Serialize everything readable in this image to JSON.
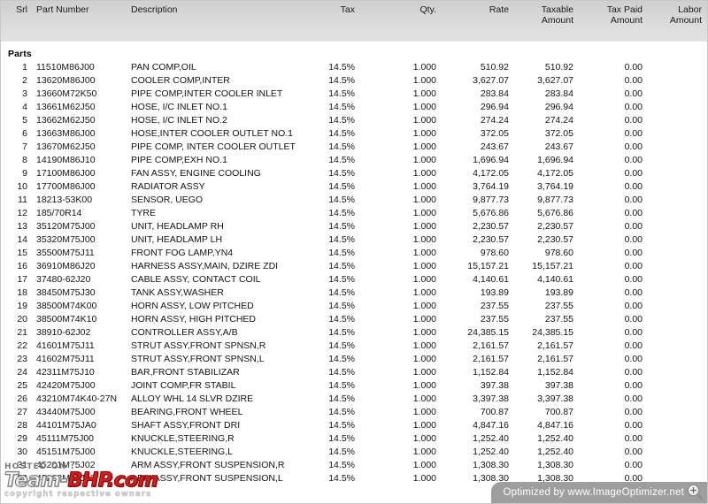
{
  "table": {
    "columns": [
      {
        "key": "srl",
        "label": "Srl"
      },
      {
        "key": "part",
        "label": "Part Number"
      },
      {
        "key": "desc",
        "label": "Description"
      },
      {
        "key": "tax",
        "label": "Tax"
      },
      {
        "key": "qty",
        "label": "Qty."
      },
      {
        "key": "rate",
        "label": "Rate"
      },
      {
        "key": "txbl",
        "label": "Taxable\nAmount"
      },
      {
        "key": "tpaid",
        "label": "Tax Paid\nAmount"
      },
      {
        "key": "labor",
        "label": "Labor\nAmount"
      }
    ],
    "group_label": "Parts",
    "rows": [
      {
        "srl": "1",
        "part": "11510M86J00",
        "desc": "PAN COMP,OIL",
        "tax": "14.5%",
        "qty": "1.000",
        "rate": "510.92",
        "txbl": "510.92",
        "tpaid": "0.00",
        "labor": ""
      },
      {
        "srl": "2",
        "part": "13620M86J00",
        "desc": "COOLER COMP,INTER",
        "tax": "14.5%",
        "qty": "1.000",
        "rate": "3,627.07",
        "txbl": "3,627.07",
        "tpaid": "0.00",
        "labor": ""
      },
      {
        "srl": "3",
        "part": "13660M72K50",
        "desc": "PIPE COMP,INTER COOLER INLET",
        "tax": "14.5%",
        "qty": "1.000",
        "rate": "283.84",
        "txbl": "283.84",
        "tpaid": "0.00",
        "labor": ""
      },
      {
        "srl": "4",
        "part": "13661M62J50",
        "desc": "HOSE, I/C INLET NO.1",
        "tax": "14.5%",
        "qty": "1.000",
        "rate": "296.94",
        "txbl": "296.94",
        "tpaid": "0.00",
        "labor": ""
      },
      {
        "srl": "5",
        "part": "13662M62J50",
        "desc": "HOSE, I/C INLET NO.2",
        "tax": "14.5%",
        "qty": "1.000",
        "rate": "274.24",
        "txbl": "274.24",
        "tpaid": "0.00",
        "labor": ""
      },
      {
        "srl": "6",
        "part": "13663M86J00",
        "desc": "HOSE,INTER COOLER OUTLET NO.1",
        "tax": "14.5%",
        "qty": "1.000",
        "rate": "372.05",
        "txbl": "372.05",
        "tpaid": "0.00",
        "labor": ""
      },
      {
        "srl": "7",
        "part": "13670M62J50",
        "desc": "PIPE COMP, INTER COOLER OUTLET",
        "tax": "14.5%",
        "qty": "1.000",
        "rate": "243.67",
        "txbl": "243.67",
        "tpaid": "0.00",
        "labor": ""
      },
      {
        "srl": "8",
        "part": "14190M86J10",
        "desc": "PIPE COMP,EXH NO.1",
        "tax": "14.5%",
        "qty": "1.000",
        "rate": "1,696.94",
        "txbl": "1,696.94",
        "tpaid": "0.00",
        "labor": ""
      },
      {
        "srl": "9",
        "part": "17100M86J00",
        "desc": "FAN ASSY, ENGINE COOLING",
        "tax": "14.5%",
        "qty": "1.000",
        "rate": "4,172.05",
        "txbl": "4,172.05",
        "tpaid": "0.00",
        "labor": ""
      },
      {
        "srl": "10",
        "part": "17700M86J00",
        "desc": "RADIATOR ASSY",
        "tax": "14.5%",
        "qty": "1.000",
        "rate": "3,764.19",
        "txbl": "3,764.19",
        "tpaid": "0.00",
        "labor": ""
      },
      {
        "srl": "11",
        "part": "18213-53K00",
        "desc": "SENSOR, UEGO",
        "tax": "14.5%",
        "qty": "1.000",
        "rate": "9,877.73",
        "txbl": "9,877.73",
        "tpaid": "0.00",
        "labor": ""
      },
      {
        "srl": "12",
        "part": "185/70R14",
        "desc": "TYRE",
        "tax": "14.5%",
        "qty": "1.000",
        "rate": "5,676.86",
        "txbl": "5,676.86",
        "tpaid": "0.00",
        "labor": ""
      },
      {
        "srl": "13",
        "part": "35120M75J00",
        "desc": "UNIT, HEADLAMP RH",
        "tax": "14.5%",
        "qty": "1.000",
        "rate": "2,230.57",
        "txbl": "2,230.57",
        "tpaid": "0.00",
        "labor": ""
      },
      {
        "srl": "14",
        "part": "35320M75J00",
        "desc": "UNIT, HEADLAMP LH",
        "tax": "14.5%",
        "qty": "1.000",
        "rate": "2,230.57",
        "txbl": "2,230.57",
        "tpaid": "0.00",
        "labor": ""
      },
      {
        "srl": "15",
        "part": "35500M75J11",
        "desc": "FRONT FOG LAMP,YN4",
        "tax": "14.5%",
        "qty": "1.000",
        "rate": "978.60",
        "txbl": "978.60",
        "tpaid": "0.00",
        "labor": ""
      },
      {
        "srl": "16",
        "part": "36910M86J20",
        "desc": "HARNESS ASSY,MAIN, DZIRE ZDI",
        "tax": "14.5%",
        "qty": "1.000",
        "rate": "15,157.21",
        "txbl": "15,157.21",
        "tpaid": "0.00",
        "labor": ""
      },
      {
        "srl": "17",
        "part": "37480-62J20",
        "desc": "CABLE ASSY, CONTACT COIL",
        "tax": "14.5%",
        "qty": "1.000",
        "rate": "4,140.61",
        "txbl": "4,140.61",
        "tpaid": "0.00",
        "labor": ""
      },
      {
        "srl": "18",
        "part": "38450M75J30",
        "desc": "TANK ASSY,WASHER",
        "tax": "14.5%",
        "qty": "1.000",
        "rate": "193.89",
        "txbl": "193.89",
        "tpaid": "0.00",
        "labor": ""
      },
      {
        "srl": "19",
        "part": "38500M74K00",
        "desc": "HORN ASSY, LOW PITCHED",
        "tax": "14.5%",
        "qty": "1.000",
        "rate": "237.55",
        "txbl": "237.55",
        "tpaid": "0.00",
        "labor": ""
      },
      {
        "srl": "20",
        "part": "38500M74K10",
        "desc": "HORN ASSY, HIGH PITCHED",
        "tax": "14.5%",
        "qty": "1.000",
        "rate": "237.55",
        "txbl": "237.55",
        "tpaid": "0.00",
        "labor": ""
      },
      {
        "srl": "21",
        "part": "38910-62J02",
        "desc": "CONTROLLER ASSY,A/B",
        "tax": "14.5%",
        "qty": "1.000",
        "rate": "24,385.15",
        "txbl": "24,385.15",
        "tpaid": "0.00",
        "labor": ""
      },
      {
        "srl": "22",
        "part": "41601M75J11",
        "desc": "STRUT ASSY,FRONT SPNSN,R",
        "tax": "14.5%",
        "qty": "1.000",
        "rate": "2,161.57",
        "txbl": "2,161.57",
        "tpaid": "0.00",
        "labor": ""
      },
      {
        "srl": "23",
        "part": "41602M75J11",
        "desc": "STRUT ASSY,FRONT SPNSN,L",
        "tax": "14.5%",
        "qty": "1.000",
        "rate": "2,161.57",
        "txbl": "2,161.57",
        "tpaid": "0.00",
        "labor": ""
      },
      {
        "srl": "24",
        "part": "42311M75J10",
        "desc": "BAR,FRONT STABILIZAR",
        "tax": "14.5%",
        "qty": "1.000",
        "rate": "1,152.84",
        "txbl": "1,152.84",
        "tpaid": "0.00",
        "labor": ""
      },
      {
        "srl": "25",
        "part": "42420M75J00",
        "desc": "JOINT COMP,FR STABIL",
        "tax": "14.5%",
        "qty": "1.000",
        "rate": "397.38",
        "txbl": "397.38",
        "tpaid": "0.00",
        "labor": ""
      },
      {
        "srl": "26",
        "part": "43210M74K40-27N",
        "desc": "ALLOY WHL 14 SLVR DZIRE",
        "tax": "14.5%",
        "qty": "1.000",
        "rate": "3,397.38",
        "txbl": "3,397.38",
        "tpaid": "0.00",
        "labor": ""
      },
      {
        "srl": "27",
        "part": "43440M75J00",
        "desc": "BEARING,FRONT WHEEL",
        "tax": "14.5%",
        "qty": "1.000",
        "rate": "700.87",
        "txbl": "700.87",
        "tpaid": "0.00",
        "labor": ""
      },
      {
        "srl": "28",
        "part": "44101M75JA0",
        "desc": "SHAFT ASSY,FRONT DRI",
        "tax": "14.5%",
        "qty": "1.000",
        "rate": "4,847.16",
        "txbl": "4,847.16",
        "tpaid": "0.00",
        "labor": ""
      },
      {
        "srl": "29",
        "part": "45111M75J00",
        "desc": "KNUCKLE,STEERING,R",
        "tax": "14.5%",
        "qty": "1.000",
        "rate": "1,252.40",
        "txbl": "1,252.40",
        "tpaid": "0.00",
        "labor": ""
      },
      {
        "srl": "30",
        "part": "45151M75J00",
        "desc": "KNUCKLE,STEERING,L",
        "tax": "14.5%",
        "qty": "1.000",
        "rate": "1,252.40",
        "txbl": "1,252.40",
        "tpaid": "0.00",
        "labor": ""
      },
      {
        "srl": "31",
        "part": "45201M75J02",
        "desc": "ARM ASSY,FRONT SUSPENSION,R",
        "tax": "14.5%",
        "qty": "1.000",
        "rate": "1,308.30",
        "txbl": "1,308.30",
        "tpaid": "0.00",
        "labor": ""
      },
      {
        "srl": "32",
        "part": "45202M75J02",
        "desc": "ARM ASSY,FRONT SUSPENSION,L",
        "tax": "14.5%",
        "qty": "1.000",
        "rate": "1,308.30",
        "txbl": "1,308.30",
        "tpaid": "0.00",
        "labor": ""
      }
    ]
  },
  "watermark": {
    "hosted_on": "HOSTED ON :",
    "logo_part1": "Team-",
    "logo_part2": "BHP.com",
    "copyright": "copyright respective owners",
    "logo_color": "#e01b1b"
  },
  "optimizer": {
    "text": "Optimized by www.ImageOptimizer.net",
    "icon": "magnifier-icon"
  }
}
